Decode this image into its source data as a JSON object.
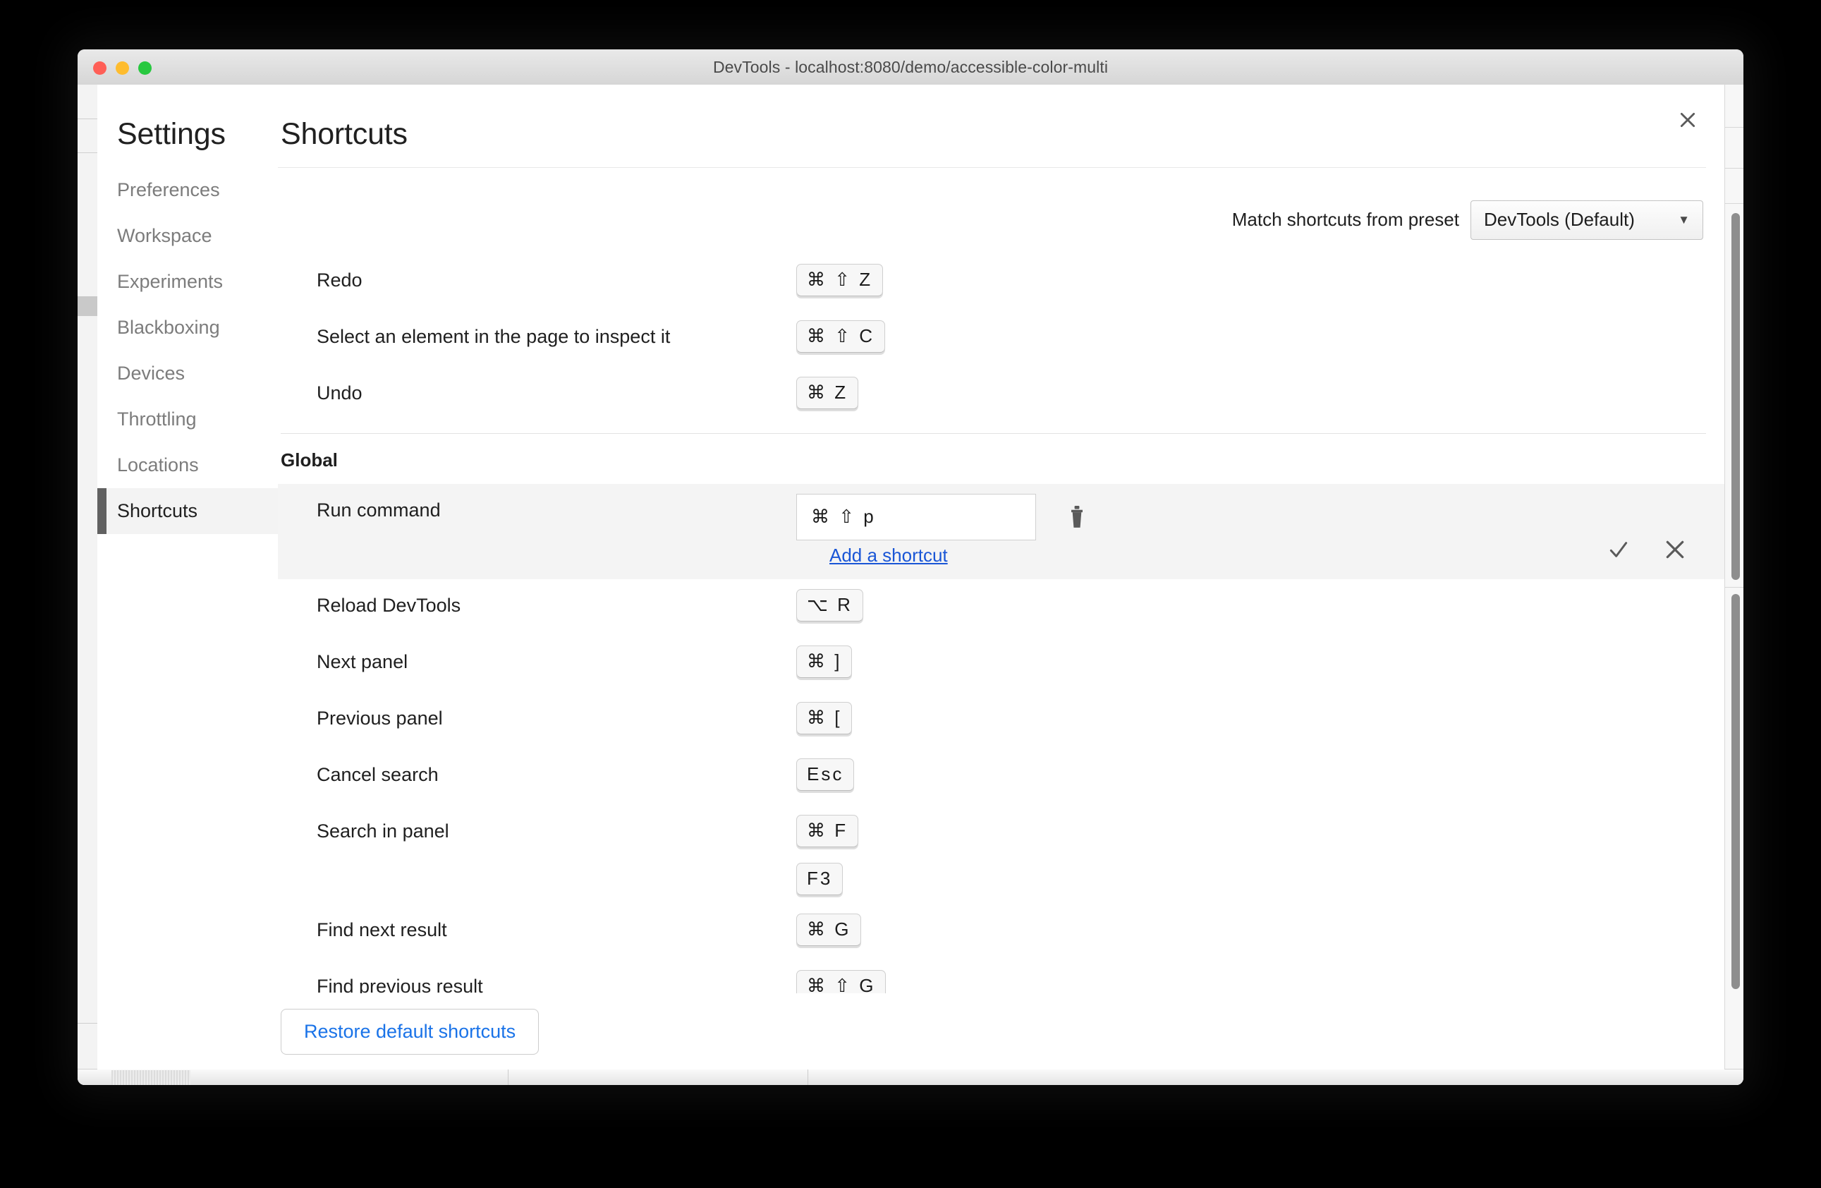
{
  "window": {
    "title": "DevTools - localhost:8080/demo/accessible-color-multi",
    "traffic_lights": [
      "close",
      "minimize",
      "zoom"
    ]
  },
  "close_icon": "close-icon",
  "sidebar": {
    "title": "Settings",
    "items": [
      {
        "label": "Preferences",
        "selected": false
      },
      {
        "label": "Workspace",
        "selected": false
      },
      {
        "label": "Experiments",
        "selected": false
      },
      {
        "label": "Blackboxing",
        "selected": false
      },
      {
        "label": "Devices",
        "selected": false
      },
      {
        "label": "Throttling",
        "selected": false
      },
      {
        "label": "Locations",
        "selected": false
      },
      {
        "label": "Shortcuts",
        "selected": true
      }
    ]
  },
  "content": {
    "title": "Shortcuts",
    "preset": {
      "label": "Match shortcuts from preset",
      "selected": "DevTools (Default)",
      "caret_icon": "chevron-down-icon"
    },
    "top_shortcuts": [
      {
        "name": "Redo",
        "keys": [
          [
            "⌘ ⇧ Z"
          ]
        ]
      },
      {
        "name": "Select an element in the page to inspect it",
        "keys": [
          [
            "⌘ ⇧ C"
          ]
        ]
      },
      {
        "name": "Undo",
        "keys": [
          [
            "⌘ Z"
          ]
        ]
      }
    ],
    "section": {
      "heading": "Global",
      "editing_row": {
        "name": "Run command",
        "input_value": "⌘ ⇧ p",
        "delete_icon": "trash-icon",
        "add_link": "Add a shortcut",
        "confirm_icon": "checkmark-icon",
        "cancel_icon": "close-icon"
      },
      "shortcuts": [
        {
          "name": "Reload DevTools",
          "keys": [
            [
              "⌥ R"
            ]
          ]
        },
        {
          "name": "Next panel",
          "keys": [
            [
              "⌘ ]"
            ]
          ]
        },
        {
          "name": "Previous panel",
          "keys": [
            [
              "⌘ ["
            ]
          ]
        },
        {
          "name": "Cancel search",
          "keys": [
            [
              "Esc"
            ]
          ]
        },
        {
          "name": "Search in panel",
          "keys": [
            [
              "⌘ F"
            ],
            [
              "F3"
            ]
          ]
        },
        {
          "name": "Find next result",
          "keys": [
            [
              "⌘ G"
            ]
          ]
        },
        {
          "name": "Find previous result",
          "keys": [
            [
              "⌘ ⇧ G"
            ]
          ]
        }
      ]
    },
    "footer": {
      "restore_label": "Restore default shortcuts"
    }
  }
}
